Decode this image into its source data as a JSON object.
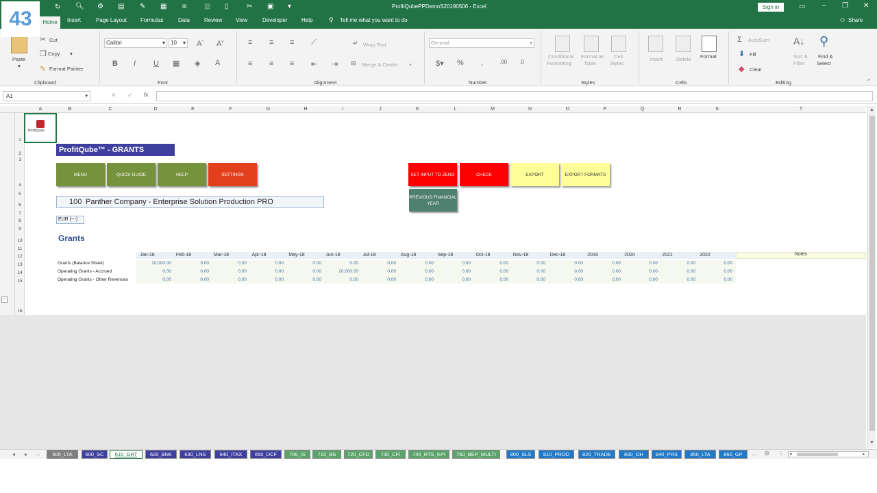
{
  "badge": "43",
  "window": {
    "title": "ProfitQubePPDemoS20190506  -  Excel",
    "signin": "Sign in"
  },
  "ribbon": {
    "tabs": [
      "Home",
      "Insert",
      "Page Layout",
      "Formulas",
      "Data",
      "Review",
      "View",
      "Developer",
      "Help"
    ],
    "tell_me": "Tell me what you want to do",
    "share": "Share",
    "clipboard": {
      "paste": "Paste",
      "cut": "Cut",
      "copy": "Copy",
      "format_painter": "Format Painter",
      "label": "Clipboard"
    },
    "font": {
      "name": "Calibri",
      "size": "10",
      "label": "Font"
    },
    "alignment": {
      "wrap": "Wrap Text",
      "merge": "Merge & Center",
      "label": "Alignment"
    },
    "number": {
      "format": "General",
      "label": "Number"
    },
    "styles": {
      "cond": "Conditional",
      "cond2": "Formatting",
      "fmt_table": "Format as",
      "fmt_table2": "Table",
      "cell_styles": "Cell",
      "cell_styles2": "Styles",
      "label": "Styles"
    },
    "cells": {
      "insert": "Insert",
      "delete": "Delete",
      "format": "Format",
      "label": "Cells"
    },
    "editing": {
      "autosum": "AutoSum",
      "fill": "Fill",
      "clear": "Clear",
      "sort": "Sort &",
      "sort2": "Filter",
      "find": "Find &",
      "find2": "Select",
      "label": "Editing"
    }
  },
  "formula_bar": {
    "name_box": "A1",
    "fx": "fx"
  },
  "columns": [
    "A",
    "B",
    "C",
    "D",
    "E",
    "F",
    "G",
    "H",
    "I",
    "J",
    "K",
    "L",
    "M",
    "N",
    "O",
    "P",
    "Q",
    "R",
    "S",
    "T"
  ],
  "rows": [
    "1",
    "2",
    "3",
    "4",
    "5",
    "6",
    "7",
    "8",
    "9",
    "10",
    "11",
    "12",
    "13",
    "14",
    "15",
    "16"
  ],
  "sheet": {
    "logo_text": "ProfitQube",
    "title": "ProfitQube™ - GRANTS",
    "buttons": {
      "menu": "MENU",
      "quick_guide": "QUICK GUIDE",
      "help": "HELP",
      "settings": "SETTINGS",
      "set_zero": "SET INPUT TO ZERO",
      "check": "CHECK",
      "export": "EXPORT",
      "export_formats": "EXPORT FORMATS",
      "prev_year": "PREVIOUS FINANCIAL YEAR"
    },
    "company_code": "100",
    "company_name": "Panther Company - Enterprise Solution Production PRO",
    "currency": "EUR (---)",
    "section": "Grants",
    "periods": [
      "Jan-18",
      "Feb-18",
      "Mar-18",
      "Apr-18",
      "May-18",
      "Jun-18",
      "Jul-18",
      "Aug-18",
      "Sep-18",
      "Oct-18",
      "Nov-18",
      "Dec-18",
      "2019",
      "2020",
      "2021",
      "2022"
    ],
    "notes_header": "Notes",
    "table": [
      {
        "label": "Grants (Balance Sheet)",
        "values": [
          "10,000.00",
          "0.00",
          "0.00",
          "0.00",
          "0.00",
          "0.00",
          "0.00",
          "0.00",
          "0.00",
          "0.00",
          "0.00",
          "0.00",
          "0.00",
          "0.00",
          "0.00",
          "0.00"
        ]
      },
      {
        "label": "Operating Grants - Accrued",
        "values": [
          "0.00",
          "0.00",
          "0.00",
          "0.00",
          "0.00",
          "20,000.00",
          "0.00",
          "0.00",
          "0.00",
          "0.00",
          "0.00",
          "0.00",
          "0.00",
          "0.00",
          "0.00",
          "0.00"
        ]
      },
      {
        "label": "Operating Grants - Other Revenues",
        "values": [
          "0.00",
          "0.00",
          "0.00",
          "0.00",
          "0.00",
          "0.00",
          "0.00",
          "0.00",
          "0.00",
          "0.00",
          "0.00",
          "0.00",
          "0.00",
          "0.00",
          "0.00",
          "0.00"
        ]
      }
    ]
  },
  "sheet_tabs": [
    {
      "name": "500_LTA",
      "color": "#7f7f7f"
    },
    {
      "name": "600_SC",
      "color": "#3f3f9f"
    },
    {
      "name": "610_GRT",
      "color": "#ffffff",
      "active": true
    },
    {
      "name": "620_BNK",
      "color": "#3f3f9f"
    },
    {
      "name": "630_LNS",
      "color": "#3f3f9f"
    },
    {
      "name": "640_ITAX",
      "color": "#3f3f9f"
    },
    {
      "name": "650_DCF",
      "color": "#3f3f9f"
    },
    {
      "name": "700_IS",
      "color": "#5aa469"
    },
    {
      "name": "710_BS",
      "color": "#5aa469"
    },
    {
      "name": "720_CFD",
      "color": "#5aa469"
    },
    {
      "name": "730_CFI",
      "color": "#5aa469"
    },
    {
      "name": "740_RTS_KPI",
      "color": "#5aa469"
    },
    {
      "name": "750_BEP_MULTI",
      "color": "#5aa469"
    },
    {
      "name": "800_SLS",
      "color": "#1f78c8"
    },
    {
      "name": "810_PROD",
      "color": "#1f78c8"
    },
    {
      "name": "820_TRADE",
      "color": "#1f78c8"
    },
    {
      "name": "830_OH",
      "color": "#1f78c8"
    },
    {
      "name": "840_PRS",
      "color": "#1f78c8"
    },
    {
      "name": "850_LTA",
      "color": "#1f78c8"
    },
    {
      "name": "860_GP",
      "color": "#1f78c8"
    }
  ]
}
